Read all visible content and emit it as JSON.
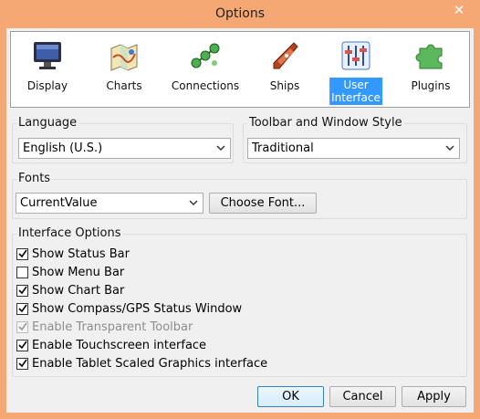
{
  "window": {
    "title": "Options",
    "close_glyph": "✕"
  },
  "toolbar": {
    "items": [
      {
        "label": "Display",
        "icon": "monitor-icon"
      },
      {
        "label": "Charts",
        "icon": "charts-icon"
      },
      {
        "label": "Connections",
        "icon": "connections-icon"
      },
      {
        "label": "Ships",
        "icon": "ship-icon"
      },
      {
        "label": "User Interface",
        "label_line1": "User",
        "label_line2": "Interface",
        "icon": "sliders-icon",
        "selected": true
      },
      {
        "label": "Plugins",
        "icon": "puzzle-icon"
      }
    ]
  },
  "language": {
    "group_label": "Language",
    "selected": "English (U.S.)"
  },
  "toolbar_style": {
    "group_label": "Toolbar and Window Style",
    "selected": "Traditional"
  },
  "fonts": {
    "group_label": "Fonts",
    "selected": "CurrentValue",
    "choose_button": "Choose Font..."
  },
  "interface_options": {
    "group_label": "Interface Options",
    "items": [
      {
        "label": "Show Status Bar",
        "checked": true,
        "enabled": true
      },
      {
        "label": "Show Menu Bar",
        "checked": false,
        "enabled": true
      },
      {
        "label": "Show Chart Bar",
        "checked": true,
        "enabled": true
      },
      {
        "label": "Show Compass/GPS Status Window",
        "checked": true,
        "enabled": true
      },
      {
        "label": "Enable Transparent Toolbar",
        "checked": true,
        "enabled": false
      },
      {
        "label": "Enable Touchscreen interface",
        "checked": true,
        "enabled": true
      },
      {
        "label": "Enable Tablet Scaled Graphics interface",
        "checked": true,
        "enabled": true
      }
    ]
  },
  "buttons": {
    "ok": "OK",
    "cancel": "Cancel",
    "apply": "Apply"
  },
  "colors": {
    "titlebar": "#f6a874",
    "selection": "#3399ff",
    "client": "#f0f0f0"
  }
}
